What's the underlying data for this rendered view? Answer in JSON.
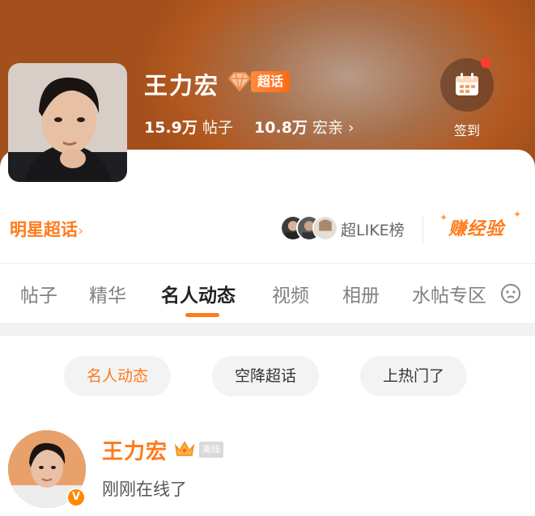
{
  "header": {
    "name": "王力宏",
    "badge_label": "超话",
    "posts_count": "15.9万",
    "posts_label": "帖子",
    "fans_count": "10.8万",
    "fans_label": "宏亲",
    "fans_chevron": "›",
    "checkin_label": "签到",
    "brand_color": "#ff7a1a"
  },
  "subbar": {
    "star_link": "明星超话",
    "star_chevron": "›",
    "like_rank": "超LIKE榜",
    "earn_exp": "赚经验"
  },
  "tabs": [
    {
      "label": "帖子",
      "active": false
    },
    {
      "label": "精华",
      "active": false
    },
    {
      "label": "名人动态",
      "active": true
    },
    {
      "label": "视频",
      "active": false
    },
    {
      "label": "相册",
      "active": false
    },
    {
      "label": "水帖专区",
      "active": false
    }
  ],
  "chips": [
    {
      "label": "名人动态",
      "active": true
    },
    {
      "label": "空降超话",
      "active": false
    },
    {
      "label": "上热门了",
      "active": false
    }
  ],
  "post": {
    "author": "王力宏",
    "status_tag": "离线",
    "verified_badge": "V",
    "text": "刚刚在线了"
  },
  "icons": {
    "diamond": "diamond-icon",
    "calendar": "calendar-icon",
    "crown": "crown-icon",
    "more": "circle-face-icon"
  }
}
